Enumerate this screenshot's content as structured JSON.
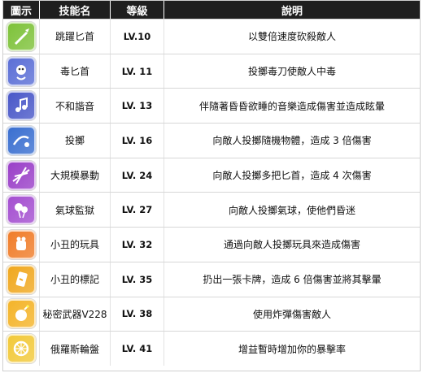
{
  "headers": {
    "icon": "圖示",
    "name": "技能名",
    "level": "等級",
    "desc": "說明"
  },
  "skills": [
    {
      "icon": "dagger-icon",
      "name": "跳躍匕首",
      "level": "LV.10",
      "desc": "以雙倍速度砍殺敵人",
      "color": "#7ec23a"
    },
    {
      "icon": "poison-clown-icon",
      "name": "毒匕首",
      "level": "LV. 11",
      "desc": "投擲毒刀使敵人中毒",
      "color": "#5b6fd6"
    },
    {
      "icon": "discord-music-icon",
      "name": "不和諧音",
      "level": "LV. 13",
      "desc": "伴隨著昏昏欲睡的音樂造成傷害並造成眩暈",
      "color": "#4a58c8"
    },
    {
      "icon": "throw-icon",
      "name": "投擲",
      "level": "LV. 16",
      "desc": "向敵人投擲隨機物體，造成 3 倍傷害",
      "color": "#3a6fd0"
    },
    {
      "icon": "blade-storm-icon",
      "name": "大規模暴動",
      "level": "LV. 24",
      "desc": "向敵人投擲多把匕首，造成 4 次傷害",
      "color": "#9a3fc8"
    },
    {
      "icon": "balloon-icon",
      "name": "氣球監獄",
      "level": "LV. 27",
      "desc": "向敵人投擲氣球，使他們昏迷",
      "color": "#a44fd0"
    },
    {
      "icon": "toy-icon",
      "name": "小丑的玩具",
      "level": "LV. 32",
      "desc": "通過向敵人投擲玩具來造成傷害",
      "color": "#f07d2a"
    },
    {
      "icon": "card-mark-icon",
      "name": "小丑的標記",
      "level": "LV. 35",
      "desc": "扔出一張卡牌，造成 6 倍傷害並將其擊暈",
      "color": "#f0a820"
    },
    {
      "icon": "bomb-icon",
      "name": "秘密武器V228",
      "level": "LV. 38",
      "desc": "使用炸彈傷害敵人",
      "color": "#f4b42a"
    },
    {
      "icon": "roulette-icon",
      "name": "俄羅斯輪盤",
      "level": "LV. 41",
      "desc": "增益暫時增加你的暴擊率",
      "color": "#f2c93a"
    }
  ]
}
